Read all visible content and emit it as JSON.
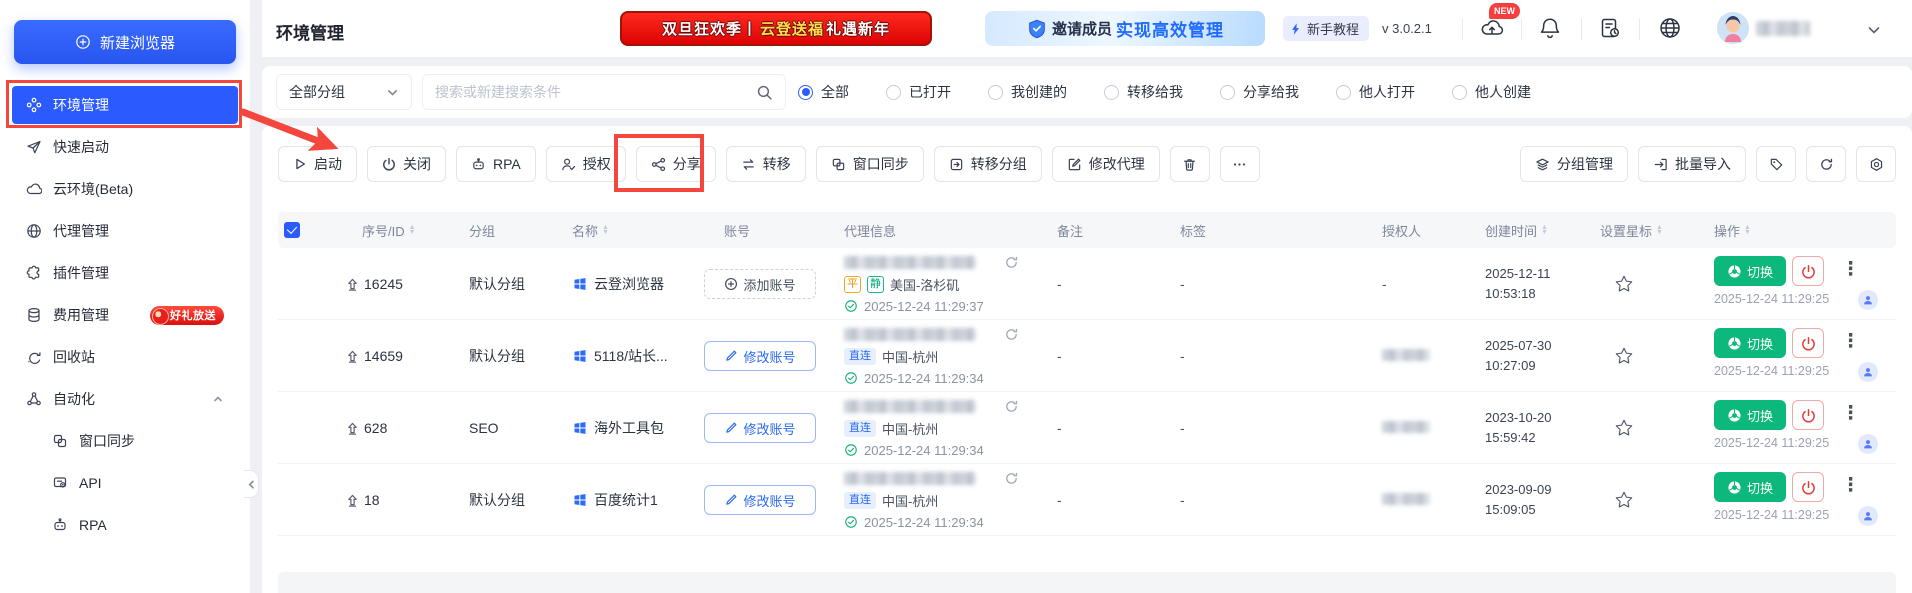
{
  "sidebar": {
    "new_browser": "新建浏览器",
    "items": [
      {
        "label": "环境管理"
      },
      {
        "label": "快速启动"
      },
      {
        "label": "云环境(Beta)"
      },
      {
        "label": "代理管理"
      },
      {
        "label": "插件管理"
      },
      {
        "label": "费用管理",
        "badge": "好礼放送"
      },
      {
        "label": "回收站"
      },
      {
        "label": "自动化"
      }
    ],
    "automation_children": [
      {
        "label": "窗口同步"
      },
      {
        "label": "API"
      },
      {
        "label": "RPA"
      }
    ]
  },
  "topbar": {
    "title": "环境管理",
    "promo_red": {
      "p1": "双旦狂欢季丨",
      "p2": "云登送福",
      "p3": "礼遇新年"
    },
    "promo_blue": {
      "prefix": "邀请成员",
      "highlight": "实现高效管理"
    },
    "tutorial": "新手教程",
    "version": "v 3.0.2.1",
    "new_badge": "NEW"
  },
  "filterbar": {
    "group_select": "全部分组",
    "search_placeholder": "搜索或新建搜索条件",
    "radios": [
      "全部",
      "已打开",
      "我创建的",
      "转移给我",
      "分享给我",
      "他人打开",
      "他人创建"
    ],
    "selected_radio": "全部"
  },
  "toolbar": {
    "start": "启动",
    "close": "关闭",
    "rpa": "RPA",
    "authorize": "授权",
    "share": "分享",
    "transfer": "转移",
    "window_sync": "窗口同步",
    "transfer_group": "转移分组",
    "modify_proxy": "修改代理",
    "group_manage": "分组管理",
    "batch_import": "批量导入"
  },
  "table": {
    "columns": {
      "id": "序号/ID",
      "group": "分组",
      "name": "名称",
      "account": "账号",
      "proxy": "代理信息",
      "note": "备注",
      "tag": "标签",
      "authorizer": "授权人",
      "created": "创建时间",
      "star": "设置星标",
      "actions": "操作"
    },
    "rows": [
      {
        "id": "16245",
        "group": "默认分组",
        "name": "云登浏览器",
        "account_action": "添加账号",
        "proxy_tags": [
          "平",
          "静"
        ],
        "proxy_location": "美国-洛杉矶",
        "proxy_time": "2025-12-24 11:29:37",
        "note": "-",
        "tag": "-",
        "authorizer": "-",
        "created_date": "2025-12-11",
        "created_clock": "10:53:18",
        "switch": "切换",
        "action_time": "2025-12-24 11:29:25"
      },
      {
        "id": "14659",
        "group": "默认分组",
        "name": "5118/站长...",
        "account_action": "修改账号",
        "proxy_tags": [
          "直连"
        ],
        "proxy_location": "中国-杭州",
        "proxy_time": "2025-12-24 11:29:34",
        "note": "-",
        "tag": "-",
        "authorizer_masked": true,
        "created_date": "2025-07-30",
        "created_clock": "10:27:09",
        "switch": "切换",
        "action_time": "2025-12-24 11:29:25"
      },
      {
        "id": "628",
        "group": "SEO",
        "name": "海外工具包",
        "account_action": "修改账号",
        "proxy_tags": [
          "直连"
        ],
        "proxy_location": "中国-杭州",
        "proxy_time": "2025-12-24 11:29:34",
        "note": "-",
        "tag": "-",
        "authorizer_masked": true,
        "created_date": "2023-10-20",
        "created_clock": "15:59:42",
        "switch": "切换",
        "action_time": "2025-12-24 11:29:25"
      },
      {
        "id": "18",
        "group": "默认分组",
        "name": "百度统计1",
        "account_action": "修改账号",
        "proxy_tags": [
          "直连"
        ],
        "proxy_location": "中国-杭州",
        "proxy_time": "2025-12-24 11:29:34",
        "note": "-",
        "tag": "-",
        "authorizer_masked": true,
        "created_date": "2023-09-09",
        "created_clock": "15:09:05",
        "switch": "切换",
        "action_time": "2025-12-24 11:29:25"
      }
    ]
  },
  "colors": {
    "primary_blue": "#2b5bfe",
    "annotation_red": "#f5463d",
    "switch_green": "#0db87c",
    "power_red": "#e23b3b",
    "promo_red": "#dd0303",
    "badge_orange": "#f5a623",
    "badge_teal": "#16b88e",
    "badge_blue": "#2a68f5"
  }
}
